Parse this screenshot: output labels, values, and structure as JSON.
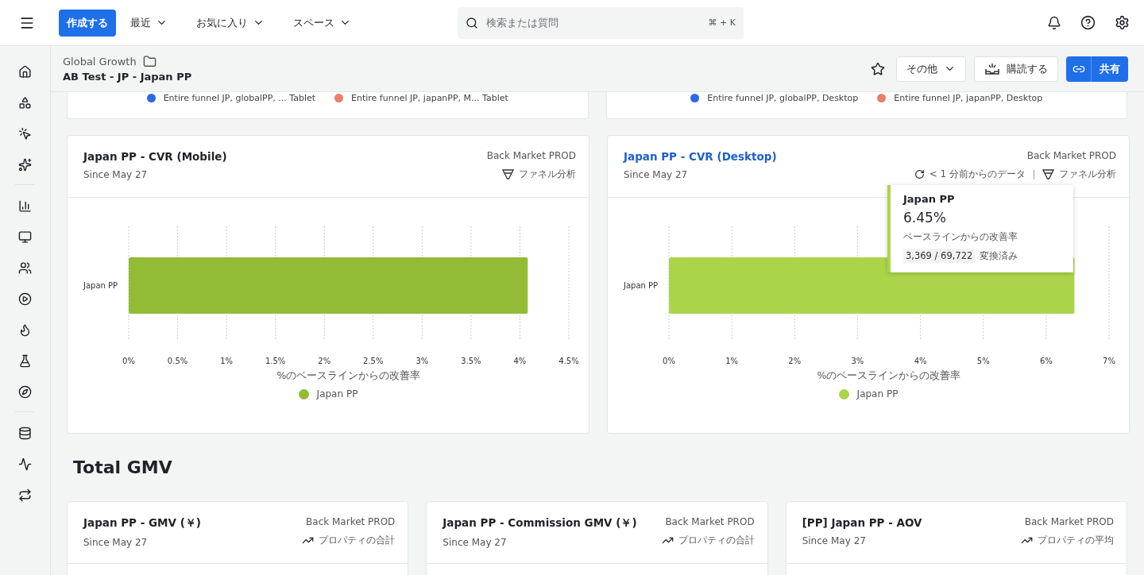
{
  "topbar": {
    "create_button": "作成する",
    "menus": [
      {
        "label": "最近"
      },
      {
        "label": "お気に入り"
      },
      {
        "label": "スペース"
      }
    ],
    "search": {
      "placeholder": "検索または質問",
      "shortcut": "⌘ + K"
    }
  },
  "header": {
    "folder": "Global Growth",
    "title": "AB Test - JP - Japan PP",
    "more_button": "その他",
    "subscribe_button": "購読する",
    "share_button": "共有"
  },
  "top_cards": [
    {
      "legend": [
        {
          "label": "Entire funnel JP, globalPP, ... Tablet",
          "color": "#2f68e6"
        },
        {
          "label": "Entire funnel JP, japanPP, M... Tablet",
          "color": "#e8806a"
        }
      ]
    },
    {
      "legend": [
        {
          "label": "Entire funnel JP, globalPP, Desktop",
          "color": "#2f68e6"
        },
        {
          "label": "Entire funnel JP, japanPP, Desktop",
          "color": "#e8806a"
        }
      ]
    }
  ],
  "chart_cards": [
    {
      "title": "Japan PP - CVR (Mobile)",
      "title_link": false,
      "since": "Since May 27",
      "project": "Back Market PROD",
      "type_label": "ファネル分析",
      "chart_data": {
        "type": "bar",
        "orientation": "horizontal",
        "grid": true,
        "categories": [
          "Japan PP"
        ],
        "xlabel": "%のベースラインからの改善率",
        "xlim": [
          0,
          4.5
        ],
        "xticks": [
          {
            "value": 0,
            "label": "0%"
          },
          {
            "value": 0.5,
            "label": "0.5%"
          },
          {
            "value": 1,
            "label": "1%"
          },
          {
            "value": 1.5,
            "label": "1.5%"
          },
          {
            "value": 2,
            "label": "2%"
          },
          {
            "value": 2.5,
            "label": "2.5%"
          },
          {
            "value": 3,
            "label": "3%"
          },
          {
            "value": 3.5,
            "label": "3.5%"
          },
          {
            "value": 4,
            "label": "4%"
          },
          {
            "value": 4.5,
            "label": "4.5%"
          }
        ],
        "series": [
          {
            "name": "Japan PP",
            "color": "#94bb36",
            "values": [
              4.08
            ]
          }
        ]
      }
    },
    {
      "title": "Japan PP - CVR (Desktop)",
      "title_link": true,
      "since": "Since May 27",
      "project": "Back Market PROD",
      "type_label": "ファネル分析",
      "freshness": "< 1 分前からのデータ",
      "chart_data": {
        "type": "bar",
        "orientation": "horizontal",
        "grid": true,
        "categories": [
          "Japan PP"
        ],
        "xlabel": "%のベースラインからの改善率",
        "xlim": [
          0,
          7
        ],
        "xticks": [
          {
            "value": 0,
            "label": "0%"
          },
          {
            "value": 1,
            "label": "1%"
          },
          {
            "value": 2,
            "label": "2%"
          },
          {
            "value": 3,
            "label": "3%"
          },
          {
            "value": 4,
            "label": "4%"
          },
          {
            "value": 5,
            "label": "5%"
          },
          {
            "value": 6,
            "label": "6%"
          },
          {
            "value": 7,
            "label": "7%"
          }
        ],
        "series": [
          {
            "name": "Japan PP",
            "color": "#acd44a",
            "values": [
              6.45
            ]
          }
        ]
      },
      "tooltip": {
        "name": "Japan PP",
        "value": "6.45%",
        "caption": "ベースラインからの改善率",
        "counts": "3,369 / 69,722",
        "counts_suffix": "変換済み"
      }
    }
  ],
  "section_title": "Total GMV",
  "gmv_cards": [
    {
      "title": "Japan PP - GMV (￥)",
      "since": "Since May 27",
      "project": "Back Market PROD",
      "type_label": "プロパティの合計"
    },
    {
      "title": "Japan PP - Commission GMV (￥)",
      "since": "Since May 27",
      "project": "Back Market PROD",
      "type_label": "プロパティの合計"
    },
    {
      "title": "[PP] Japan PP - AOV",
      "since": "Since May 27",
      "project": "Back Market PROD",
      "type_label": "プロパティの平均"
    }
  ]
}
